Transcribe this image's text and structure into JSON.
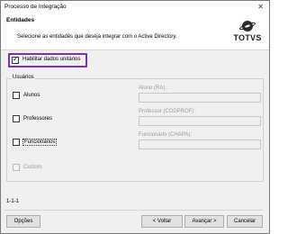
{
  "window": {
    "title": "Processo de Integração",
    "close_glyph": "✕"
  },
  "header": {
    "title": "Entidades",
    "description": "Selecione as entidades que deseja integrar com o Active Directory.",
    "logo_text": "TOTVS"
  },
  "options": {
    "habilitar_label": "Habilitar dados unitários",
    "habilitar_checked": true
  },
  "usuarios": {
    "legend": "Usuários",
    "rows": [
      {
        "label": "Alunos",
        "checked": false,
        "enabled": true,
        "field_label": "Aluno (RA):",
        "field_value": ""
      },
      {
        "label": "Professores",
        "checked": false,
        "enabled": true,
        "field_label": "Professor (CODPROF):",
        "field_value": ""
      },
      {
        "label": "Funcionários",
        "checked": false,
        "enabled": true,
        "focused": true,
        "field_label": "Funcionário (CHAPA):",
        "field_value": ""
      },
      {
        "label": "Custom",
        "checked": false,
        "enabled": false
      }
    ]
  },
  "footer": {
    "version": "1-1-1",
    "opcoes_label": "Opções",
    "voltar_label": "< Voltar",
    "avancar_label": "Avançar >",
    "cancelar_label": "Cancelar"
  },
  "colors": {
    "highlight": "#7b2fbe",
    "dialog_bg": "#f0f0f0",
    "header_bg": "#ffffff"
  }
}
